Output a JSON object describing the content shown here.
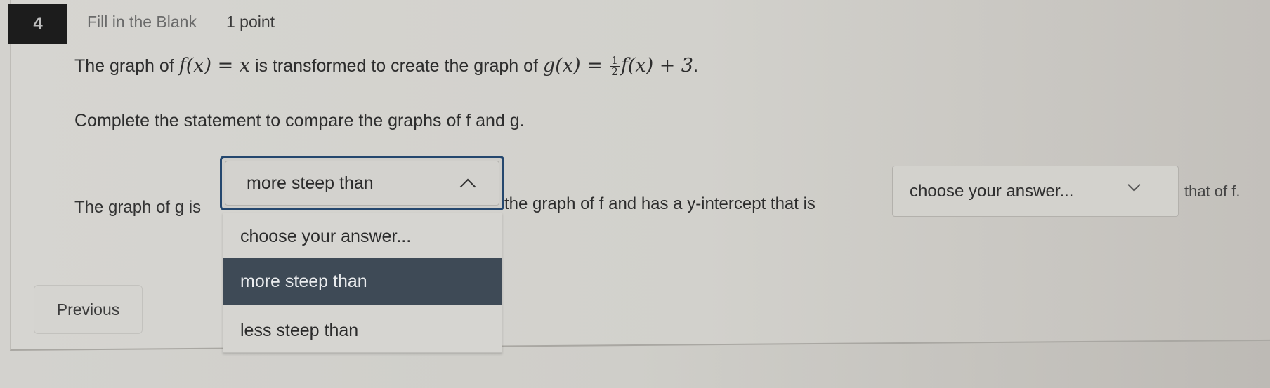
{
  "question": {
    "number": "4",
    "type": "Fill in the Blank",
    "points": "1 point",
    "prompt": {
      "pre": "The graph of ",
      "f_expr": "f(x) = x",
      "mid": " is transformed to create the graph of ",
      "g_lhs": "g(x) = ",
      "frac_num": "1",
      "frac_den": "2",
      "g_rhs": "f(x) + 3",
      "end": "."
    },
    "instruction": "Complete the statement to compare the graphs of f and g.",
    "sentence": {
      "part1": "The graph of g is",
      "part2": "the graph of f and has a y-intercept that is",
      "part3": "that of f."
    }
  },
  "dropdown_steepness": {
    "selected": "more steep than",
    "open": true,
    "options": [
      {
        "label": "choose your answer...",
        "highlighted": false
      },
      {
        "label": "more steep than",
        "highlighted": true
      },
      {
        "label": "less steep than",
        "highlighted": false
      }
    ],
    "focus_color": "#24476e",
    "highlight_color": "#3e4a56"
  },
  "dropdown_intercept": {
    "selected": "choose your answer...",
    "open": false
  },
  "nav": {
    "previous_label": "Previous"
  }
}
